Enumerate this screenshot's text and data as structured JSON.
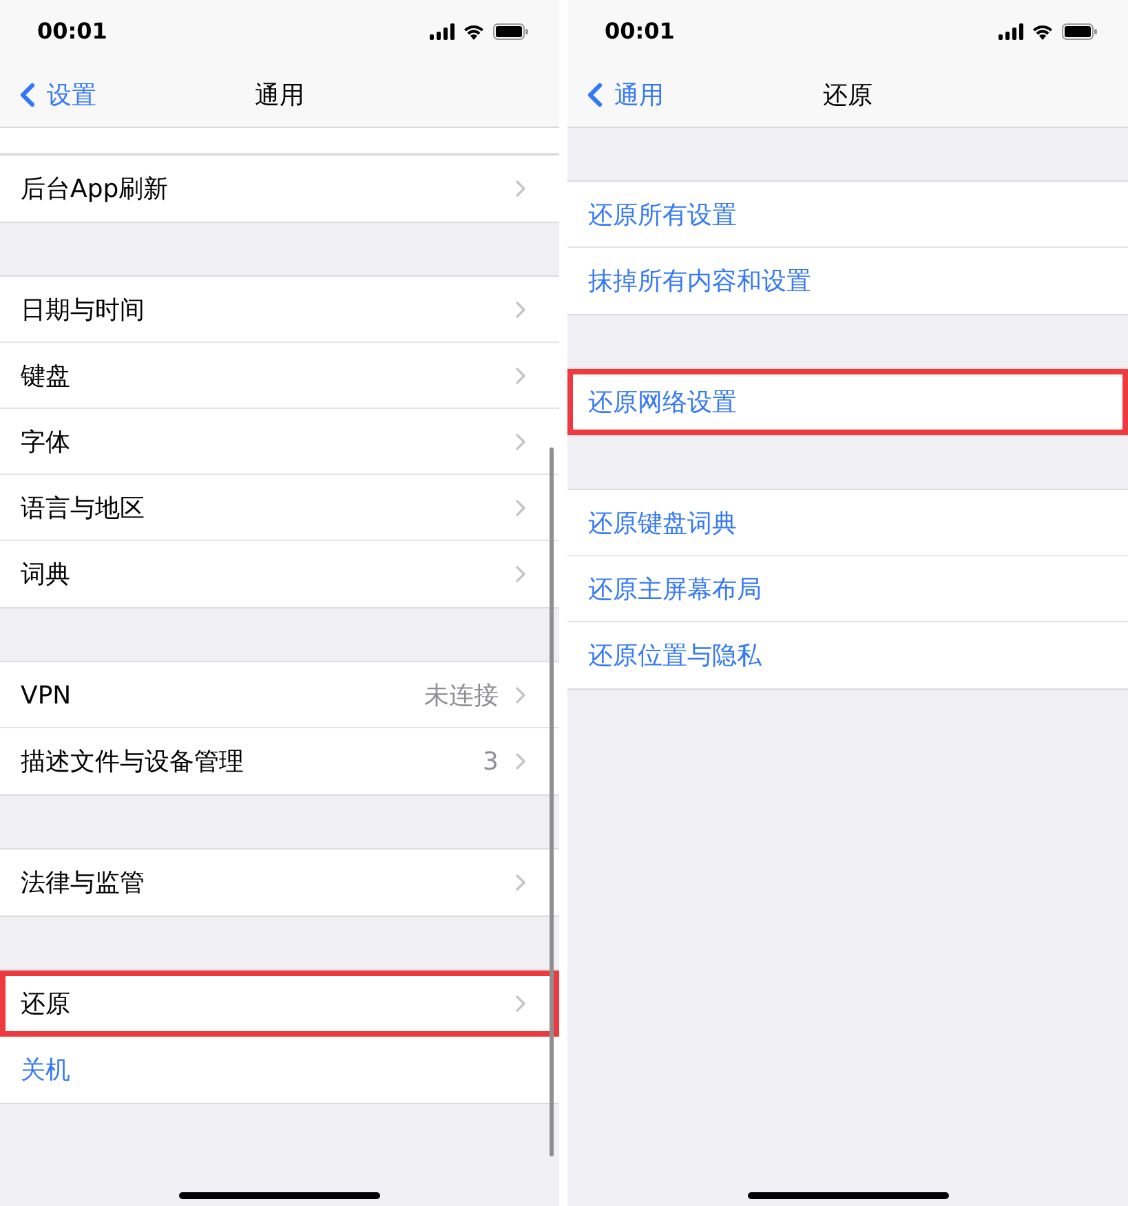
{
  "screens": [
    {
      "status_bar": {
        "time": "00:01"
      },
      "nav": {
        "back": "设置",
        "title": "通用"
      },
      "scrolled": true,
      "groups": [
        {
          "clipped": true,
          "items": [
            {
              "label": "后台App刷新",
              "kind": "link",
              "highlighted": false
            }
          ]
        },
        {
          "clipped": false,
          "items": [
            {
              "label": "日期与时间",
              "kind": "link",
              "highlighted": false
            },
            {
              "label": "键盘",
              "kind": "link",
              "highlighted": false
            },
            {
              "label": "字体",
              "kind": "link",
              "highlighted": false
            },
            {
              "label": "语言与地区",
              "kind": "link",
              "highlighted": false
            },
            {
              "label": "词典",
              "kind": "link",
              "highlighted": false
            }
          ]
        },
        {
          "clipped": false,
          "items": [
            {
              "label": "VPN",
              "kind": "link",
              "detail": "未连接",
              "highlighted": false
            },
            {
              "label": "描述文件与设备管理",
              "kind": "link",
              "detail": "3",
              "highlighted": false
            }
          ]
        },
        {
          "clipped": false,
          "items": [
            {
              "label": "法律与监管",
              "kind": "link",
              "highlighted": false
            }
          ]
        },
        {
          "clipped": false,
          "items": [
            {
              "label": "还原",
              "kind": "link",
              "highlighted": true
            },
            {
              "label": "关机",
              "kind": "action",
              "highlighted": false
            }
          ]
        }
      ]
    },
    {
      "status_bar": {
        "time": "00:01"
      },
      "nav": {
        "back": "通用",
        "title": "还原"
      },
      "scrolled": false,
      "groups": [
        {
          "clipped": false,
          "items": [
            {
              "label": "还原所有设置",
              "kind": "action",
              "highlighted": false
            },
            {
              "label": "抹掉所有内容和设置",
              "kind": "action",
              "highlighted": false
            }
          ]
        },
        {
          "clipped": false,
          "items": [
            {
              "label": "还原网络设置",
              "kind": "action",
              "highlighted": true
            }
          ]
        },
        {
          "clipped": false,
          "items": [
            {
              "label": "还原键盘词典",
              "kind": "action",
              "highlighted": false
            },
            {
              "label": "还原主屏幕布局",
              "kind": "action",
              "highlighted": false
            },
            {
              "label": "还原位置与隐私",
              "kind": "action",
              "highlighted": false
            }
          ]
        }
      ]
    }
  ]
}
